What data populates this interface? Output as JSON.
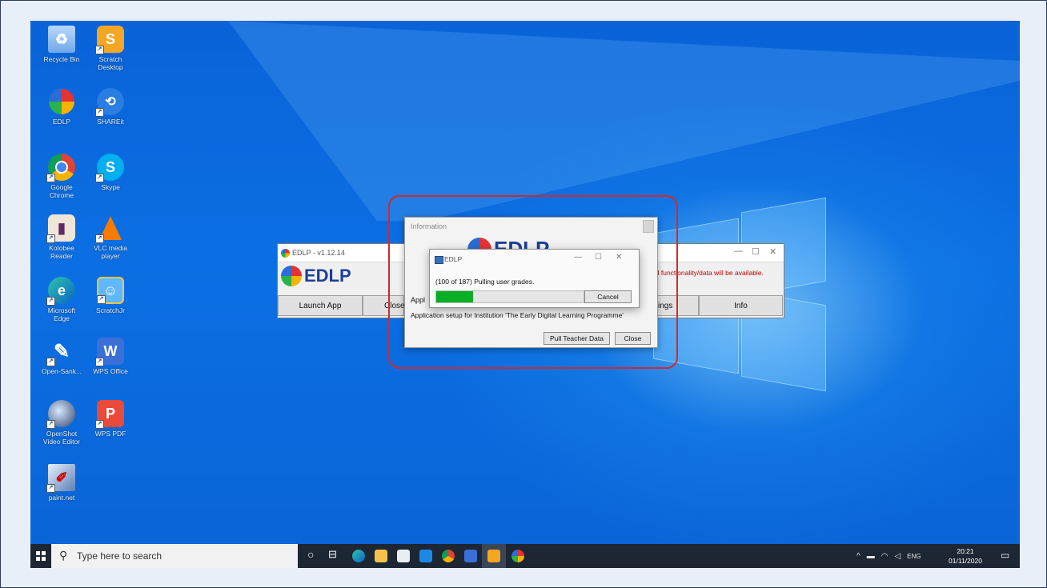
{
  "desktop_icons": [
    {
      "label": "Recycle Bin",
      "icon": "recycle-bin-icon"
    },
    {
      "label": "Scratch Desktop",
      "icon": "scratch-desktop-icon"
    },
    {
      "label": "EDLP",
      "icon": "edlp-icon"
    },
    {
      "label": "SHAREit",
      "icon": "shareit-icon"
    },
    {
      "label": "Google Chrome",
      "icon": "chrome-icon"
    },
    {
      "label": "Skype",
      "icon": "skype-icon"
    },
    {
      "label": "Kotobee Reader",
      "icon": "kotobee-icon"
    },
    {
      "label": "VLC media player",
      "icon": "vlc-icon"
    },
    {
      "label": "Microsoft Edge",
      "icon": "edge-icon"
    },
    {
      "label": "ScratchJr",
      "icon": "scratchjr-icon"
    },
    {
      "label": "Open-Sank...",
      "icon": "open-sankore-icon"
    },
    {
      "label": "WPS Office",
      "icon": "wps-office-icon"
    },
    {
      "label": "OpenShot Video Editor",
      "icon": "openshot-icon"
    },
    {
      "label": "WPS PDF",
      "icon": "wps-pdf-icon"
    },
    {
      "label": "paint.net",
      "icon": "paintnet-icon"
    }
  ],
  "main_window": {
    "title": "EDLP - v1.12.14",
    "logo_text": "EDLP",
    "warning_fragment": "all functionality/data will be available.",
    "buttons": [
      "Launch App",
      "Close",
      "ings",
      "Info"
    ]
  },
  "info_dialog": {
    "title": "Information",
    "logo_text": "EDLP",
    "partial_line": "Appl",
    "message": "Application setup for Institution 'The Early Digital Learning Programme'",
    "pull_button": "Pull Teacher Data",
    "close_button": "Close"
  },
  "progress_dialog": {
    "title": "EDLP",
    "status": "(100 of 187) Pulling user grades.",
    "progress": 0.25,
    "cancel_button": "Cancel"
  },
  "taskbar": {
    "search_placeholder": "Type here to search",
    "apps": [
      "task-view-icon",
      "cortana-icon",
      "edge-icon",
      "file-explorer-icon",
      "store-icon",
      "mail-icon",
      "chrome-icon",
      "wps-icon",
      "scratch-icon",
      "edlp-icon"
    ],
    "tray_lang": "ENG",
    "time": "20:21",
    "date": "01/11/2020"
  },
  "colors": {
    "desktop": "#0b6fe3",
    "progress_fill": "#06b025",
    "highlight": "#d02a2a",
    "warning": "#c00000"
  }
}
